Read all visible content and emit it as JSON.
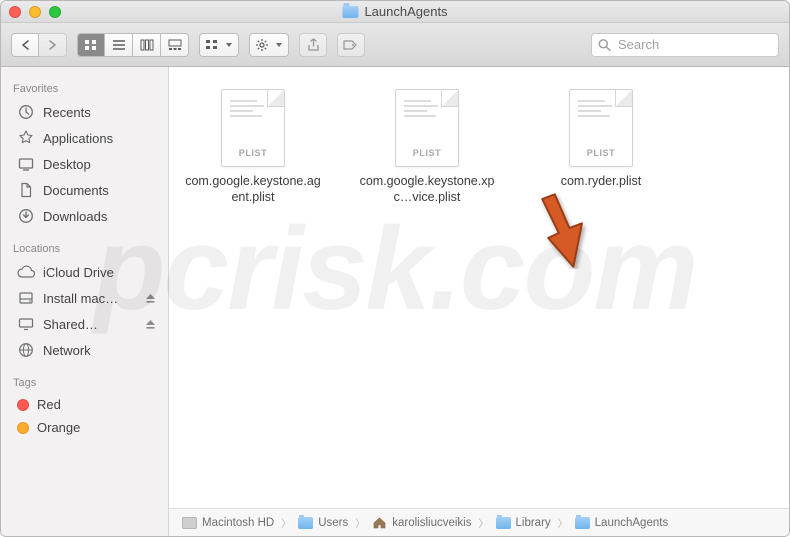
{
  "window": {
    "title": "LaunchAgents"
  },
  "search": {
    "placeholder": "Search"
  },
  "sidebar": {
    "sections": [
      {
        "label": "Favorites",
        "items": [
          {
            "label": "Recents"
          },
          {
            "label": "Applications"
          },
          {
            "label": "Desktop"
          },
          {
            "label": "Documents"
          },
          {
            "label": "Downloads"
          }
        ]
      },
      {
        "label": "Locations",
        "items": [
          {
            "label": "iCloud Drive"
          },
          {
            "label": "Install mac…"
          },
          {
            "label": "Shared…"
          },
          {
            "label": "Network"
          }
        ]
      },
      {
        "label": "Tags",
        "items": [
          {
            "label": "Red"
          },
          {
            "label": "Orange"
          }
        ]
      }
    ]
  },
  "content": {
    "files": [
      {
        "label": "com.google.keystone.agent.plist",
        "badge": "PLIST"
      },
      {
        "label": "com.google.keystone.xpc…vice.plist",
        "badge": "PLIST"
      },
      {
        "label": "com.ryder.plist",
        "badge": "PLIST"
      }
    ]
  },
  "pathbar": {
    "crumbs": [
      {
        "label": "Macintosh HD",
        "kind": "hd"
      },
      {
        "label": "Users",
        "kind": "folder"
      },
      {
        "label": "karolisliucveikis",
        "kind": "home"
      },
      {
        "label": "Library",
        "kind": "folder"
      },
      {
        "label": "LaunchAgents",
        "kind": "folder"
      }
    ]
  },
  "watermark": {
    "text": "pcrisk.com"
  }
}
